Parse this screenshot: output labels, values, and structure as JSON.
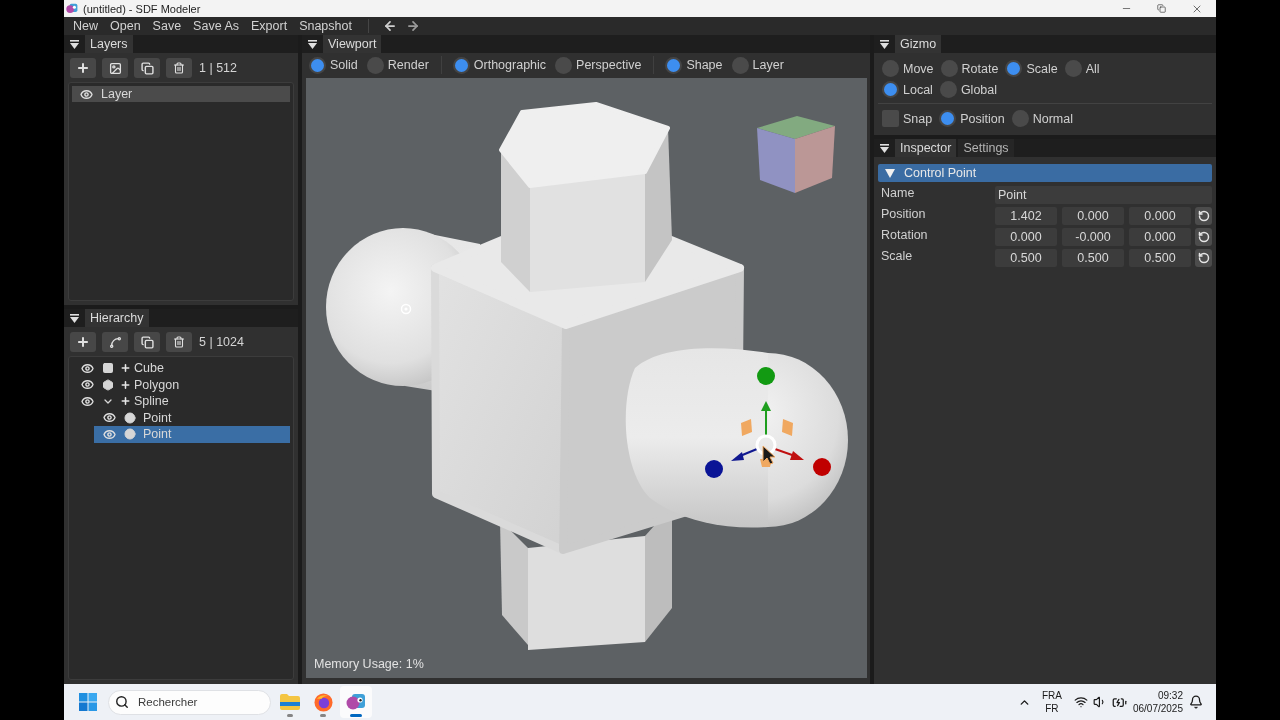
{
  "window": {
    "title": "(untitled) - SDF Modeler"
  },
  "menu": [
    {
      "label": "New"
    },
    {
      "label": "Open"
    },
    {
      "label": "Save"
    },
    {
      "label": "Save As"
    },
    {
      "label": "Export"
    },
    {
      "label": "Snapshot"
    }
  ],
  "layers": {
    "tab": "Layers",
    "count": "1 | 512",
    "items": [
      {
        "name": "Layer",
        "selected": true
      }
    ]
  },
  "hierarchy": {
    "tab": "Hierarchy",
    "count": "5 | 1024",
    "items": [
      {
        "name": "Cube",
        "kind": "cube",
        "selected": false
      },
      {
        "name": "Polygon",
        "kind": "polygon",
        "selected": false
      },
      {
        "name": "Spline",
        "kind": "spline",
        "selected": false,
        "expanded": true,
        "children": [
          {
            "name": "Point",
            "kind": "point",
            "selected": false
          },
          {
            "name": "Point",
            "kind": "point",
            "selected": true
          }
        ]
      }
    ]
  },
  "viewport": {
    "tab": "Viewport",
    "option_groups": [
      {
        "options": [
          {
            "label": "Solid",
            "selected": true
          },
          {
            "label": "Render",
            "selected": false
          }
        ]
      },
      {
        "options": [
          {
            "label": "Orthographic",
            "selected": true
          },
          {
            "label": "Perspective",
            "selected": false
          }
        ]
      },
      {
        "options": [
          {
            "label": "Shape",
            "selected": true
          },
          {
            "label": "Layer",
            "selected": false
          }
        ]
      }
    ],
    "memory_usage": "Memory Usage: 1%"
  },
  "gizmo": {
    "tab": "Gizmo",
    "modes": [
      {
        "label": "Move",
        "selected": false
      },
      {
        "label": "Rotate",
        "selected": false
      },
      {
        "label": "Scale",
        "selected": true
      },
      {
        "label": "All",
        "selected": false
      }
    ],
    "spaces": [
      {
        "label": "Local",
        "selected": true
      },
      {
        "label": "Global",
        "selected": false
      }
    ],
    "snap": {
      "label": "Snap",
      "checked": false
    },
    "snap_targets": [
      {
        "label": "Position",
        "selected": true
      },
      {
        "label": "Normal",
        "selected": false
      }
    ]
  },
  "inspector": {
    "tabs": [
      {
        "label": "Inspector",
        "selected": true
      },
      {
        "label": "Settings",
        "selected": false
      }
    ],
    "section": {
      "title": "Control Point",
      "expanded": true
    },
    "fields": [
      {
        "label": "Name",
        "kind": "text",
        "value": "Point"
      },
      {
        "label": "Position",
        "kind": "vector",
        "values": [
          "1.402",
          "0.000",
          "0.000"
        ]
      },
      {
        "label": "Rotation",
        "kind": "vector",
        "values": [
          "0.000",
          "-0.000",
          "0.000"
        ]
      },
      {
        "label": "Scale",
        "kind": "vector",
        "values": [
          "0.500",
          "0.500",
          "0.500"
        ]
      }
    ]
  },
  "taskbar": {
    "search_placeholder": "Rechercher",
    "apps": [
      {
        "kind": "folder",
        "active": false
      },
      {
        "kind": "browser",
        "active": false
      },
      {
        "kind": "modeler",
        "active": true
      }
    ],
    "tray": {
      "language": "FRA",
      "layout": "FR",
      "time": "09:32",
      "date": "06/07/2025"
    }
  }
}
